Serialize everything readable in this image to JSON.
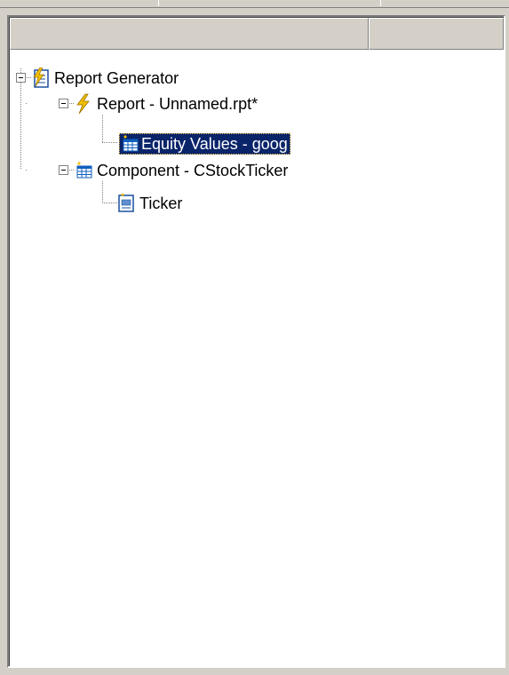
{
  "tree": {
    "nodes": [
      {
        "label": "Report Generator",
        "icon": "report-generator-icon",
        "level": 0,
        "expanded": true
      },
      {
        "label": "Report - Unnamed.rpt*",
        "icon": "lightning-icon",
        "level": 1,
        "expanded": true
      },
      {
        "label": "Equity Values - goog",
        "icon": "table-icon",
        "level": 2,
        "selected": true
      },
      {
        "label": "Component - CStockTicker",
        "icon": "table-icon",
        "level": 1,
        "expanded": true
      },
      {
        "label": "Ticker",
        "icon": "document-icon",
        "level": 2
      }
    ]
  },
  "colors": {
    "selection": "#0a246a",
    "lightning": "#f0c000",
    "table_icon": "#1060c0"
  }
}
